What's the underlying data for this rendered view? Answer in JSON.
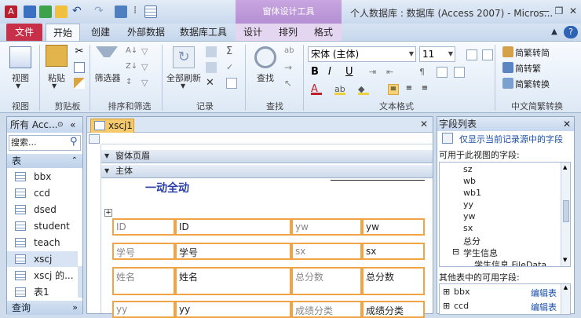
{
  "title_bar": {
    "context_tab": "窗体设计工具",
    "window_title": "个人数据库 : 数据库 (Access 2007) - Micros..."
  },
  "tabs": [
    {
      "label": "文件"
    },
    {
      "label": "开始"
    },
    {
      "label": "创建"
    },
    {
      "label": "外部数据"
    },
    {
      "label": "数据库工具"
    },
    {
      "label": "设计"
    },
    {
      "label": "排列"
    },
    {
      "label": "格式"
    }
  ],
  "ribbon": {
    "view": {
      "button": "视图",
      "group": "视图"
    },
    "clipboard": {
      "button": "粘贴",
      "group": "剪贴板"
    },
    "sort": {
      "button": "筛选器",
      "group": "排序和筛选"
    },
    "records": {
      "button": "全部刷新",
      "group": "记录"
    },
    "find": {
      "button": "查找",
      "group": "查找"
    },
    "text": {
      "font": "宋体 (主体)",
      "size": "11",
      "group": "文本格式"
    },
    "convert": {
      "items": [
        "简繁转简",
        "简转繁",
        "简繁转换"
      ],
      "group": "中文简繁转换"
    }
  },
  "nav": {
    "header": "所有 Acc...",
    "search_placeholder": "搜索...",
    "section_tables": "表",
    "tables": [
      "bbx",
      "ccd",
      "dsed",
      "student",
      "teach",
      "xscj",
      "xscj 的...",
      "表1"
    ],
    "section_queries": "查询"
  },
  "document": {
    "tab": "xscj1",
    "section_header": "窗体页眉",
    "section_body": "主体",
    "form_title": "一动全动",
    "rows": [
      [
        "ID",
        "ID",
        "yw",
        "yw"
      ],
      [
        "学号",
        "学号",
        "sx",
        "sx"
      ],
      [
        "姓名",
        "姓名",
        "总分数",
        "总分数"
      ],
      [
        "yy",
        "yy",
        "成绩分类",
        "成绩分类"
      ]
    ]
  },
  "field_list": {
    "title": "字段列表",
    "show_only": "仅显示当前记录源中的字段",
    "available_label": "可用于此视图的字段:",
    "fields": [
      "sz",
      "wb",
      "wb1",
      "yy",
      "yw",
      "sx",
      "总分"
    ],
    "group": "学生信息",
    "group_field": "学生信息.FileData",
    "other_label": "其他表中的可用字段:",
    "other_tables": [
      {
        "name": "bbx",
        "action": "编辑表"
      },
      {
        "name": "ccd",
        "action": "编辑表"
      }
    ]
  }
}
